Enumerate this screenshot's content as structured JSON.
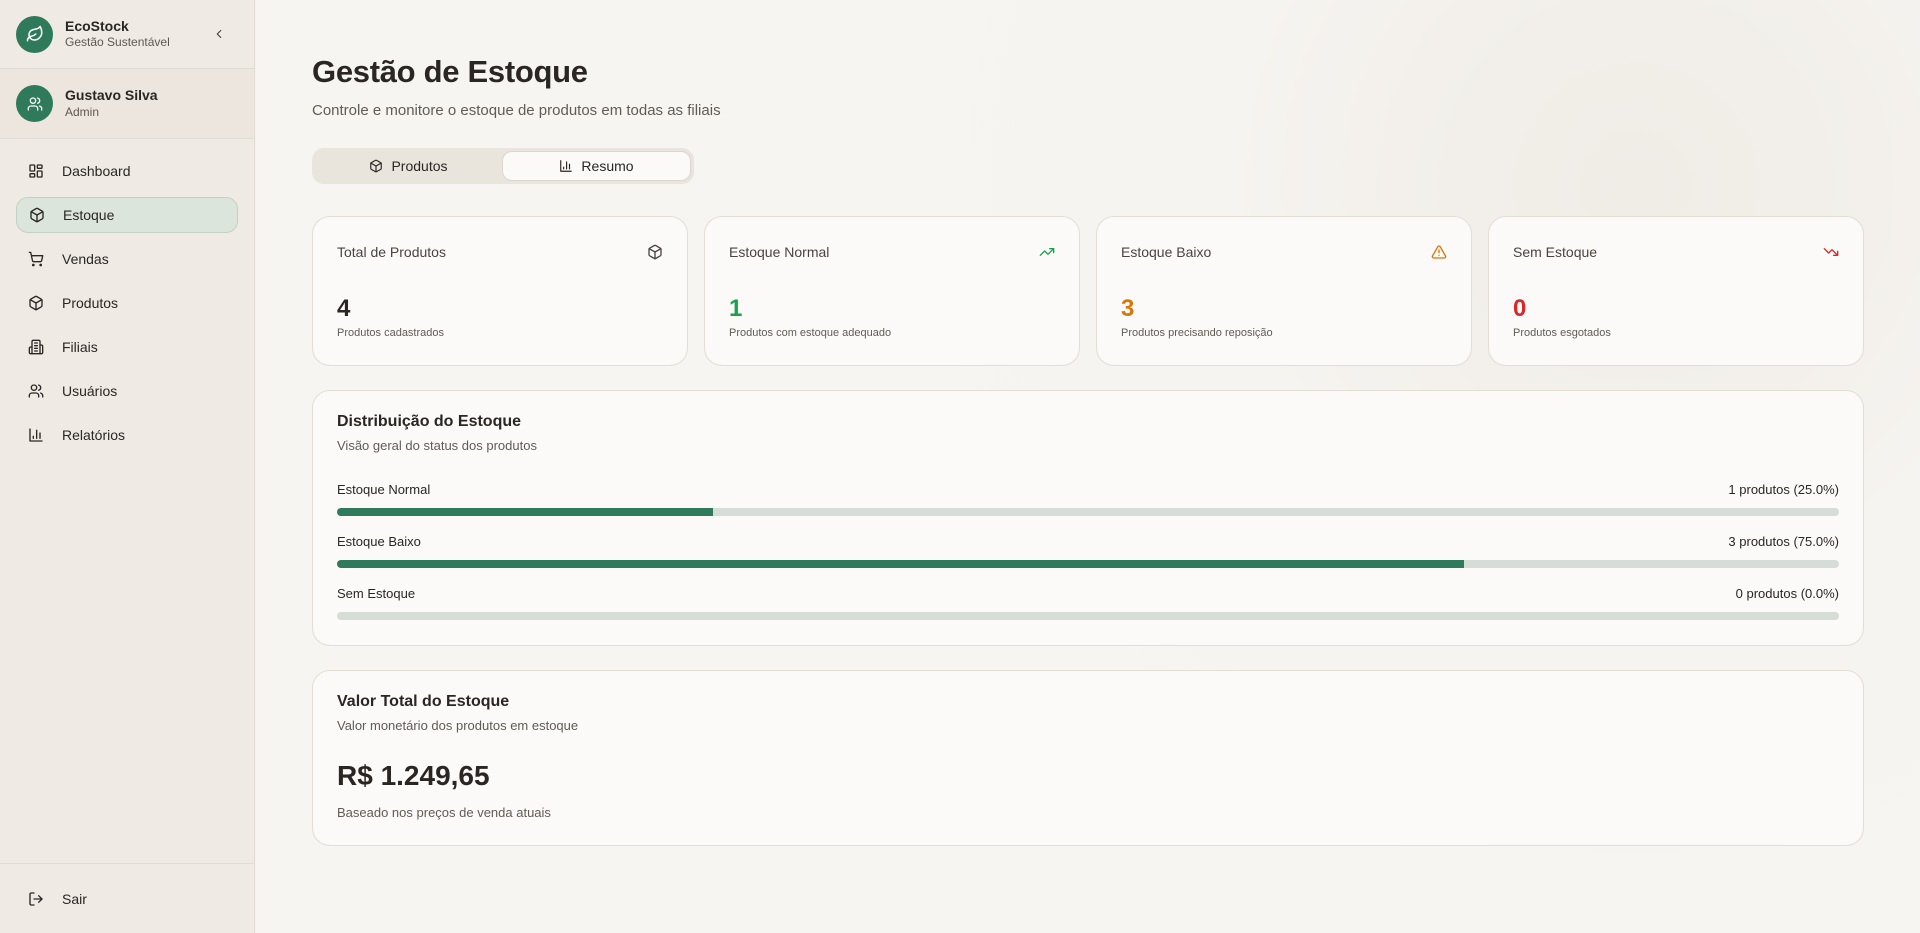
{
  "brand": {
    "title": "EcoStock",
    "subtitle": "Gestão Sustentável"
  },
  "user": {
    "name": "Gustavo Silva",
    "role": "Admin"
  },
  "nav": {
    "items": [
      {
        "label": "Dashboard",
        "icon": "dashboard-icon"
      },
      {
        "label": "Estoque",
        "icon": "package-icon",
        "active": true
      },
      {
        "label": "Vendas",
        "icon": "cart-icon"
      },
      {
        "label": "Produtos",
        "icon": "box-icon"
      },
      {
        "label": "Filiais",
        "icon": "building-icon"
      },
      {
        "label": "Usuários",
        "icon": "users-icon"
      },
      {
        "label": "Relatórios",
        "icon": "bar-chart-icon"
      }
    ],
    "logout": "Sair"
  },
  "header": {
    "title": "Gestão de Estoque",
    "subtitle": "Controle e monitore o estoque de produtos em todas as filiais"
  },
  "tabs": [
    {
      "label": "Produtos",
      "icon": "package-icon"
    },
    {
      "label": "Resumo",
      "icon": "bar-chart-icon",
      "active": true
    }
  ],
  "stats": [
    {
      "title": "Total de Produtos",
      "value": "4",
      "desc": "Produtos cadastrados",
      "icon": "package-icon",
      "color": "#2a2623"
    },
    {
      "title": "Estoque Normal",
      "value": "1",
      "desc": "Produtos com estoque adequado",
      "icon": "trending-up-icon",
      "color": "#16a34a"
    },
    {
      "title": "Estoque Baixo",
      "value": "3",
      "desc": "Produtos precisando reposição",
      "icon": "alert-triangle-icon",
      "color": "#d97706"
    },
    {
      "title": "Sem Estoque",
      "value": "0",
      "desc": "Produtos esgotados",
      "icon": "trending-down-icon",
      "color": "#dc2626"
    }
  ],
  "distribution": {
    "title": "Distribuição do Estoque",
    "subtitle": "Visão geral do status dos produtos",
    "rows": [
      {
        "label": "Estoque Normal",
        "count": "1 produtos (25.0%)",
        "percent": 25
      },
      {
        "label": "Estoque Baixo",
        "count": "3 produtos (75.0%)",
        "percent": 75
      },
      {
        "label": "Sem Estoque",
        "count": "0 produtos (0.0%)",
        "percent": 0
      }
    ]
  },
  "total_value": {
    "title": "Valor Total do Estoque",
    "subtitle": "Valor monetário dos produtos em estoque",
    "value": "R$ 1.249,65",
    "note": "Baseado nos preços de venda atuais"
  },
  "colors": {
    "accent": "#2f7a5a",
    "track": "#d5ddd6",
    "active_nav": "#dbe5dc"
  }
}
